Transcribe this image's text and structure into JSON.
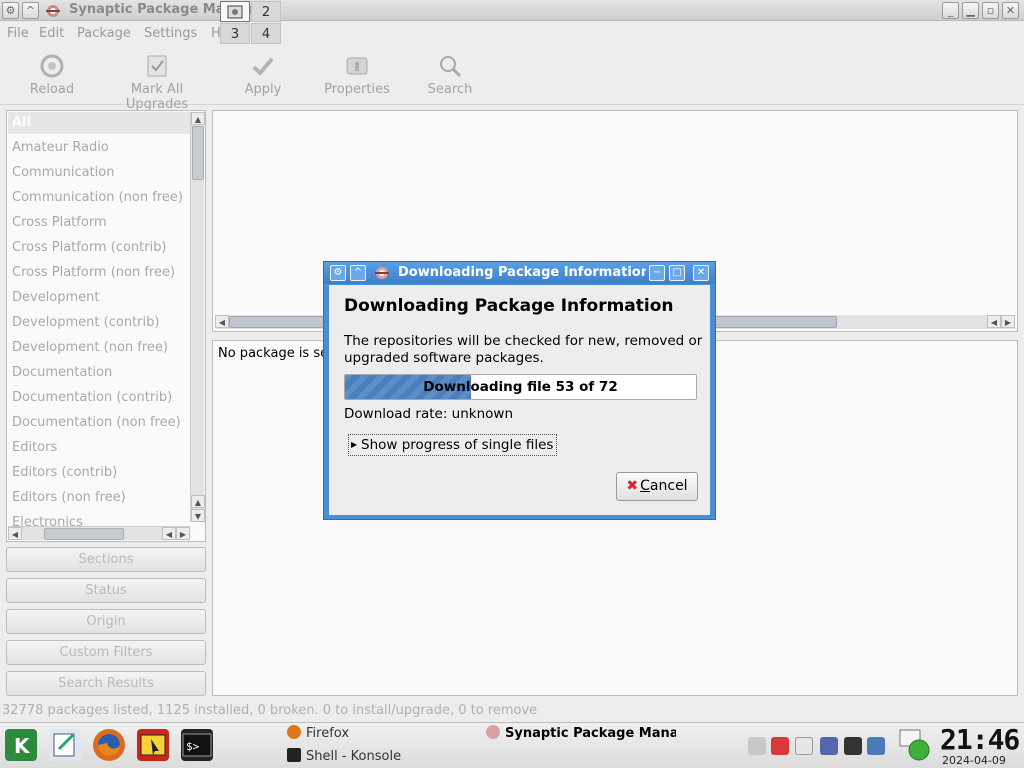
{
  "window": {
    "title": "Synaptic Package Manager"
  },
  "menu": [
    "File",
    "Edit",
    "Package",
    "Settings",
    "Help"
  ],
  "toolbar": [
    {
      "label": "Reload",
      "icon": "reload-icon"
    },
    {
      "label": "Mark All Upgrades",
      "icon": "mark-upgrades-icon"
    },
    {
      "label": "Apply",
      "icon": "apply-icon"
    },
    {
      "label": "Properties",
      "icon": "properties-icon"
    },
    {
      "label": "Search",
      "icon": "search-icon"
    }
  ],
  "categories": [
    "All",
    "Amateur Radio",
    "Communication",
    "Communication (non free)",
    "Cross Platform",
    "Cross Platform (contrib)",
    "Cross Platform (non free)",
    "Development",
    "Development (contrib)",
    "Development (non free)",
    "Documentation",
    "Documentation (contrib)",
    "Documentation (non free)",
    "Editors",
    "Editors (contrib)",
    "Editors (non free)",
    "Electronics"
  ],
  "filters": [
    "Sections",
    "Status",
    "Origin",
    "Custom Filters",
    "Search Results"
  ],
  "details": {
    "empty_text": "No package is se"
  },
  "status": {
    "text": "32778 packages listed, 1125 installed, 0 broken. 0 to install/upgrade, 0 to remove"
  },
  "dialog": {
    "title": "Downloading Package Information",
    "heading": "Downloading Package Information",
    "description": "The repositories will be checked for new, removed or upgraded software packages.",
    "progress_text": "Downloading file 53 of 72",
    "progress_fraction": 0.36,
    "rate": "Download rate: unknown",
    "expander_label": "Show progress of single files",
    "cancel_label": "Cancel",
    "cancel_mnemonic": "C",
    "cancel_rest": "ancel"
  },
  "taskbar": {
    "pager": [
      "1",
      "2",
      "3",
      "4"
    ],
    "tasks": [
      {
        "label": "Firefox",
        "icon": "firefox-icon"
      },
      {
        "label": "Shell - Konsole",
        "icon": "konsole-icon"
      },
      {
        "label": "Synaptic Package Mana",
        "icon": "synaptic-icon"
      }
    ],
    "clock": "21:46",
    "date": "2024-04-09"
  },
  "colors": {
    "dialog_frame": "#4a8fd6",
    "progress_fill": "#5b8fc9"
  }
}
